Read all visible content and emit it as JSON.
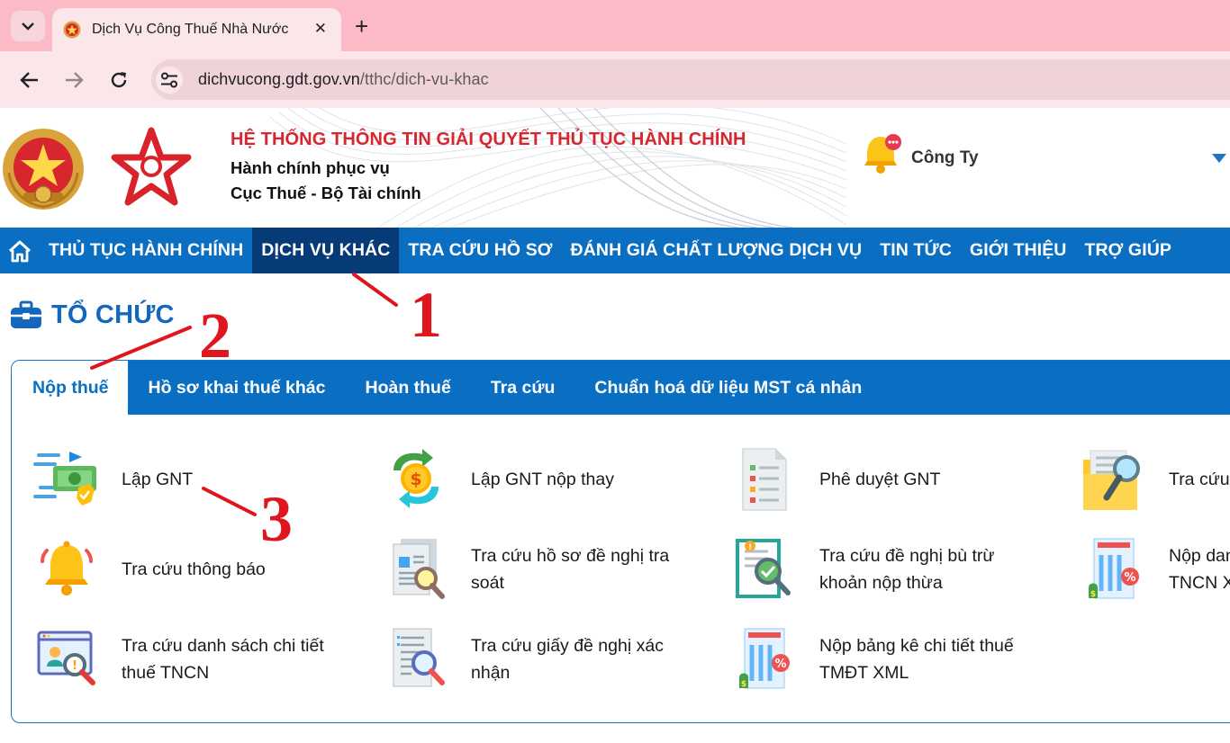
{
  "browser": {
    "tab_title": "Dịch Vụ Công Thuế Nhà Nước",
    "url_host": "dichvucong.gdt.gov.vn",
    "url_path": "/tthc/dich-vu-khac",
    "tab_menu_icon": "chevron-down-icon",
    "close_icon": "close-icon",
    "new_tab_icon": "plus-icon",
    "back_icon": "arrow-left-icon",
    "forward_icon": "arrow-right-icon",
    "reload_icon": "reload-icon",
    "site_info_icon": "tune-icon"
  },
  "header": {
    "title": "HỆ THỐNG THÔNG TIN GIẢI QUYẾT THỦ TỤC HÀNH CHÍNH",
    "subtitle1": "Hành chính phục vụ",
    "subtitle2": "Cục Thuế - Bộ Tài chính",
    "user_name": "Công Ty",
    "title_color": "#d7262e"
  },
  "mainnav": {
    "items": [
      {
        "label": "THỦ TỤC HÀNH CHÍNH",
        "active": false
      },
      {
        "label": "DỊCH VỤ KHÁC",
        "active": true
      },
      {
        "label": "TRA CỨU HỒ SƠ",
        "active": false
      },
      {
        "label": "ĐÁNH GIÁ CHẤT LƯỢNG DỊCH VỤ",
        "active": false
      },
      {
        "label": "TIN TỨC",
        "active": false
      },
      {
        "label": "GIỚI THIỆU",
        "active": false
      },
      {
        "label": "TRỢ GIÚP",
        "active": false
      }
    ],
    "color": "#0a6fc2",
    "active_color": "#073b78"
  },
  "section": {
    "title": "TỔ CHỨC"
  },
  "panel": {
    "tabs": [
      {
        "label": "Nộp thuế",
        "active": true
      },
      {
        "label": "Hồ sơ khai thuế khác",
        "active": false
      },
      {
        "label": "Hoàn thuế",
        "active": false
      },
      {
        "label": "Tra cứu",
        "active": false
      },
      {
        "label": "Chuẩn hoá dữ liệu MST cá nhân",
        "active": false
      }
    ],
    "services": [
      {
        "label": "Lập GNT",
        "icon": "money-transfer-icon"
      },
      {
        "label": "Lập GNT nộp thay",
        "icon": "coin-exchange-icon"
      },
      {
        "label": "Phê duyệt GNT",
        "icon": "checklist-document-icon"
      },
      {
        "label": "Tra cứu",
        "icon": "folder-search-icon"
      },
      {
        "label": "Tra cứu thông báo",
        "icon": "bell-icon"
      },
      {
        "label": "Tra cứu hồ sơ đề nghị tra soát",
        "line1": "Tra cứu hồ sơ đề nghị tra",
        "line2": "soát",
        "icon": "document-search-icon"
      },
      {
        "label": "Tra cứu đề nghị bù trừ khoản nộp thừa",
        "line1": "Tra cứu đề nghị bù trừ",
        "line2": "khoản nộp thừa",
        "icon": "report-check-icon"
      },
      {
        "label": "Nộp dan... TNCN X...",
        "line1": "Nộp dan",
        "line2": "TNCN X",
        "icon": "tax-list-icon"
      },
      {
        "label": "Tra cứu danh sách chi tiết thuế TNCN",
        "line1": "Tra cứu danh sách chi tiết",
        "line2": "thuế TNCN",
        "icon": "profile-search-icon"
      },
      {
        "label": "Tra cứu giấy đề nghị xác nhận",
        "line1": "Tra cứu giấy đề nghị xác",
        "line2": "nhận",
        "icon": "paper-search-icon"
      },
      {
        "label": "Nộp bảng kê chi tiết thuế TMĐT XML",
        "line1": "Nộp bảng kê chi tiết thuế",
        "line2": "TMĐT XML",
        "icon": "tax-percent-icon"
      }
    ]
  },
  "annotations": [
    "1",
    "2",
    "3"
  ],
  "annotation_color": "#e0161f"
}
